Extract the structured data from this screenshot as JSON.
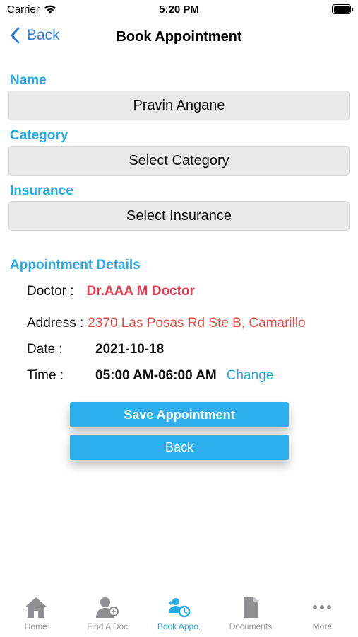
{
  "status_bar": {
    "carrier": "Carrier",
    "time": "5:20 PM"
  },
  "nav": {
    "back_label": "Back",
    "title": "Book Appointment"
  },
  "form": {
    "name_label": "Name",
    "name_value": "Pravin Angane",
    "category_label": "Category",
    "category_value": "Select Category",
    "insurance_label": "Insurance",
    "insurance_value": "Select Insurance"
  },
  "details": {
    "section_title": "Appointment Details",
    "doctor_key": "Doctor :",
    "doctor_value": "Dr.AAA M Doctor",
    "address_key": "Address :",
    "address_value": "2370 Las Posas Rd Ste B, Camarillo",
    "date_key": "Date :",
    "date_value": "2021-10-18",
    "time_key": "Time :",
    "time_value": "05:00 AM-06:00 AM",
    "change_label": "Change"
  },
  "buttons": {
    "save_label": "Save Appointment",
    "back_label": "Back"
  },
  "tabs": [
    {
      "label": "Home",
      "icon": "home-icon",
      "active": false
    },
    {
      "label": "Find A Doc",
      "icon": "doctor-icon",
      "active": false
    },
    {
      "label": "Book Appo.",
      "icon": "book-appointment-icon",
      "active": true
    },
    {
      "label": "Documents",
      "icon": "document-icon",
      "active": false
    },
    {
      "label": "More",
      "icon": "more-icon",
      "active": false
    }
  ],
  "colors": {
    "accent": "#29a8e6",
    "button": "#2fb0ee",
    "doctor_red": "#e83a4f",
    "address_red": "#e84b3f",
    "field_bg": "#e9e9ec"
  }
}
